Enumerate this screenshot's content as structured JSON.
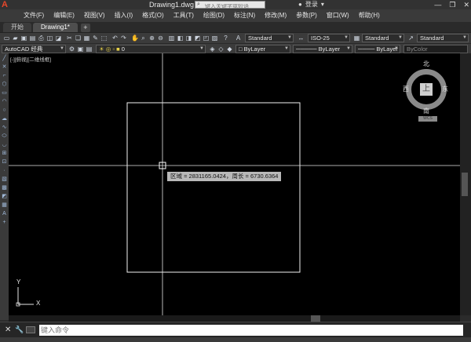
{
  "window": {
    "file_title": "Drawing1.dwg",
    "search_placeholder": "键入关键字或短语",
    "login_label": "登录",
    "app_logo": "A"
  },
  "menu": [
    "文件(F)",
    "编辑(E)",
    "视图(V)",
    "插入(I)",
    "格式(O)",
    "工具(T)",
    "绘图(D)",
    "标注(N)",
    "修改(M)",
    "参数(P)",
    "窗口(W)",
    "帮助(H)"
  ],
  "tabs": [
    {
      "label": "开始",
      "active": false
    },
    {
      "label": "Drawing1*",
      "active": true
    }
  ],
  "toolbar1": {
    "text_style": "Standard",
    "dim_style": "ISO-25",
    "table_style": "Standard",
    "mleader_style": "Standard"
  },
  "toolbar2": {
    "workspace": "AutoCAD 经典",
    "layer": "0",
    "color": "ByLayer",
    "linetype": "ByLayer",
    "lineweight": "ByLayer",
    "plotstyle": "ByColor"
  },
  "viewport": {
    "label": "[-][俯视][二维线框]"
  },
  "viewcube": {
    "north": "北",
    "south": "南",
    "east": "东",
    "west": "西",
    "face": "上",
    "wcs": "WCS"
  },
  "readout": {
    "text": "区域 = 2831165.0424，周长 = 6730.6364"
  },
  "ucs": {
    "x_label": "X",
    "y_label": "Y"
  },
  "command": {
    "placeholder": "键入命令"
  }
}
